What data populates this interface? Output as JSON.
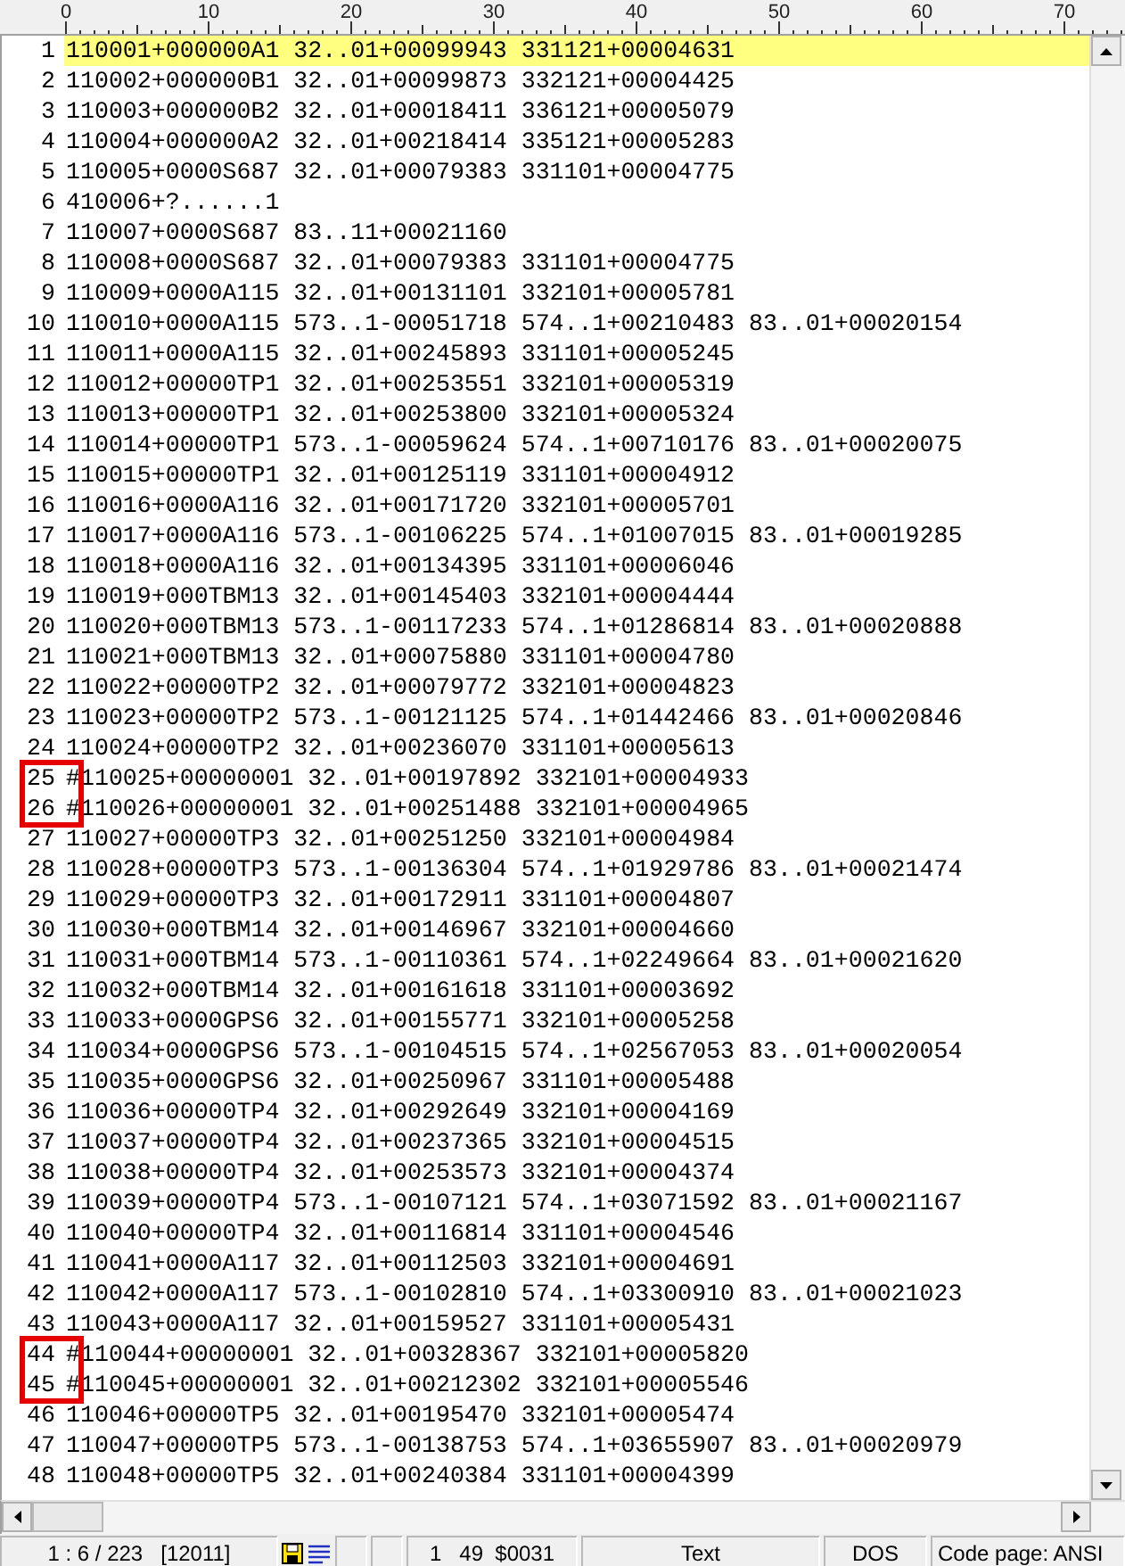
{
  "ruler": [
    "0",
    "10",
    "20",
    "30",
    "40",
    "50",
    "60",
    "70"
  ],
  "lines": [
    {
      "number": "1",
      "text": "110001+000000A1 32..01+00099943 331121+00004631",
      "current": true,
      "boxed": false
    },
    {
      "number": "2",
      "text": "110002+000000B1 32..01+00099873 332121+00004425",
      "current": false,
      "boxed": false
    },
    {
      "number": "3",
      "text": "110003+000000B2 32..01+00018411 336121+00005079",
      "current": false,
      "boxed": false
    },
    {
      "number": "4",
      "text": "110004+000000A2 32..01+00218414 335121+00005283",
      "current": false,
      "boxed": false
    },
    {
      "number": "5",
      "text": "110005+0000S687 32..01+00079383 331101+00004775",
      "current": false,
      "boxed": false
    },
    {
      "number": "6",
      "text": "410006+?......1",
      "current": false,
      "boxed": false
    },
    {
      "number": "7",
      "text": "110007+0000S687 83..11+00021160",
      "current": false,
      "boxed": false
    },
    {
      "number": "8",
      "text": "110008+0000S687 32..01+00079383 331101+00004775",
      "current": false,
      "boxed": false
    },
    {
      "number": "9",
      "text": "110009+0000A115 32..01+00131101 332101+00005781",
      "current": false,
      "boxed": false
    },
    {
      "number": "10",
      "text": "110010+0000A115 573..1-00051718 574..1+00210483 83..01+00020154",
      "current": false,
      "boxed": false
    },
    {
      "number": "11",
      "text": "110011+0000A115 32..01+00245893 331101+00005245",
      "current": false,
      "boxed": false
    },
    {
      "number": "12",
      "text": "110012+00000TP1 32..01+00253551 332101+00005319",
      "current": false,
      "boxed": false
    },
    {
      "number": "13",
      "text": "110013+00000TP1 32..01+00253800 332101+00005324",
      "current": false,
      "boxed": false
    },
    {
      "number": "14",
      "text": "110014+00000TP1 573..1-00059624 574..1+00710176 83..01+00020075",
      "current": false,
      "boxed": false
    },
    {
      "number": "15",
      "text": "110015+00000TP1 32..01+00125119 331101+00004912",
      "current": false,
      "boxed": false
    },
    {
      "number": "16",
      "text": "110016+0000A116 32..01+00171720 332101+00005701",
      "current": false,
      "boxed": false
    },
    {
      "number": "17",
      "text": "110017+0000A116 573..1-00106225 574..1+01007015 83..01+00019285",
      "current": false,
      "boxed": false
    },
    {
      "number": "18",
      "text": "110018+0000A116 32..01+00134395 331101+00006046",
      "current": false,
      "boxed": false
    },
    {
      "number": "19",
      "text": "110019+000TBM13 32..01+00145403 332101+00004444",
      "current": false,
      "boxed": false
    },
    {
      "number": "20",
      "text": "110020+000TBM13 573..1-00117233 574..1+01286814 83..01+00020888",
      "current": false,
      "boxed": false
    },
    {
      "number": "21",
      "text": "110021+000TBM13 32..01+00075880 331101+00004780",
      "current": false,
      "boxed": false
    },
    {
      "number": "22",
      "text": "110022+00000TP2 32..01+00079772 332101+00004823",
      "current": false,
      "boxed": false
    },
    {
      "number": "23",
      "text": "110023+00000TP2 573..1-00121125 574..1+01442466 83..01+00020846",
      "current": false,
      "boxed": false
    },
    {
      "number": "24",
      "text": "110024+00000TP2 32..01+00236070 331101+00005613",
      "current": false,
      "boxed": false
    },
    {
      "number": "25",
      "text": "#110025+00000001 32..01+00197892 332101+00004933",
      "current": false,
      "boxed": true
    },
    {
      "number": "26",
      "text": "#110026+00000001 32..01+00251488 332101+00004965",
      "current": false,
      "boxed": true
    },
    {
      "number": "27",
      "text": "110027+00000TP3 32..01+00251250 332101+00004984",
      "current": false,
      "boxed": false
    },
    {
      "number": "28",
      "text": "110028+00000TP3 573..1-00136304 574..1+01929786 83..01+00021474",
      "current": false,
      "boxed": false
    },
    {
      "number": "29",
      "text": "110029+00000TP3 32..01+00172911 331101+00004807",
      "current": false,
      "boxed": false
    },
    {
      "number": "30",
      "text": "110030+000TBM14 32..01+00146967 332101+00004660",
      "current": false,
      "boxed": false
    },
    {
      "number": "31",
      "text": "110031+000TBM14 573..1-00110361 574..1+02249664 83..01+00021620",
      "current": false,
      "boxed": false
    },
    {
      "number": "32",
      "text": "110032+000TBM14 32..01+00161618 331101+00003692",
      "current": false,
      "boxed": false
    },
    {
      "number": "33",
      "text": "110033+0000GPS6 32..01+00155771 332101+00005258",
      "current": false,
      "boxed": false
    },
    {
      "number": "34",
      "text": "110034+0000GPS6 573..1-00104515 574..1+02567053 83..01+00020054",
      "current": false,
      "boxed": false
    },
    {
      "number": "35",
      "text": "110035+0000GPS6 32..01+00250967 331101+00005488",
      "current": false,
      "boxed": false
    },
    {
      "number": "36",
      "text": "110036+00000TP4 32..01+00292649 332101+00004169",
      "current": false,
      "boxed": false
    },
    {
      "number": "37",
      "text": "110037+00000TP4 32..01+00237365 332101+00004515",
      "current": false,
      "boxed": false
    },
    {
      "number": "38",
      "text": "110038+00000TP4 32..01+00253573 332101+00004374",
      "current": false,
      "boxed": false
    },
    {
      "number": "39",
      "text": "110039+00000TP4 573..1-00107121 574..1+03071592 83..01+00021167",
      "current": false,
      "boxed": false
    },
    {
      "number": "40",
      "text": "110040+00000TP4 32..01+00116814 331101+00004546",
      "current": false,
      "boxed": false
    },
    {
      "number": "41",
      "text": "110041+0000A117 32..01+00112503 332101+00004691",
      "current": false,
      "boxed": false
    },
    {
      "number": "42",
      "text": "110042+0000A117 573..1-00102810 574..1+03300910 83..01+00021023",
      "current": false,
      "boxed": false
    },
    {
      "number": "43",
      "text": "110043+0000A117 32..01+00159527 331101+00005431",
      "current": false,
      "boxed": false
    },
    {
      "number": "44",
      "text": "#110044+00000001 32..01+00328367 332101+00005820",
      "current": false,
      "boxed": true
    },
    {
      "number": "45",
      "text": "#110045+00000001 32..01+00212302 332101+00005546",
      "current": false,
      "boxed": true
    },
    {
      "number": "46",
      "text": "110046+00000TP5 32..01+00195470 332101+00005474",
      "current": false,
      "boxed": false
    },
    {
      "number": "47",
      "text": "110047+00000TP5 573..1-00138753 574..1+03655907 83..01+00020979",
      "current": false,
      "boxed": false
    },
    {
      "number": "48",
      "text": "110048+00000TP5 32..01+00240384 331101+00004399",
      "current": false,
      "boxed": false
    }
  ],
  "status_bar": {
    "position": "1 : 6 / 223",
    "size": "[12011]",
    "cursor": "1   49  $0031",
    "mode": "Text",
    "line_ending": "DOS",
    "code_page": "Code page: ANSI"
  }
}
